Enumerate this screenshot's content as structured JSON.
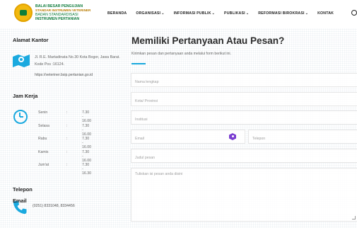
{
  "header": {
    "brand_line1": "BALAI BESAR PENGUJIAN",
    "brand_line2": "STANDAR INSTRUMEN VETERINER",
    "brand_line3": "BADAN STANDARDISASI",
    "brand_line4": "INSTRUMEN PERTANIAN",
    "nav": [
      {
        "label": "BERANDA",
        "chevron": false
      },
      {
        "label": "ORGANISASI",
        "chevron": true
      },
      {
        "label": "INFORMASI PUBLIK",
        "chevron": true
      },
      {
        "label": "PUBLIKASI",
        "chevron": true
      },
      {
        "label": "REFORMASI BIROKRASI",
        "chevron": true
      },
      {
        "label": "KONTAK",
        "chevron": false
      }
    ],
    "chevron_glyph": "⌄"
  },
  "left": {
    "address_title": "Alamat Kantor",
    "address": "Jl. R.E. Martadinata No.30 Kota Bogor, Jawa Barat. Kode Pos :16124.",
    "url": "https://veteriner.bsip.pertanian.go.id",
    "hours_title": "Jam Kerja",
    "hours": [
      {
        "day": "Senin",
        "sep": ":",
        "time": "7.30 - 16.00"
      },
      {
        "day": "Selasa",
        "sep": ":",
        "time": "7.30 - 16.00"
      },
      {
        "day": "Rabu",
        "sep": ":",
        "time": "7.30 - 16.00"
      },
      {
        "day": "Kamis",
        "sep": ":",
        "time": "7.30 - 16.00"
      },
      {
        "day": "Jum'at",
        "sep": ":",
        "time": "7.30 - 16.30"
      }
    ],
    "phone_title": "Telepon",
    "phone": "(0251) 8331048, 8334456",
    "email_title": "Email"
  },
  "form": {
    "title": "Memiliki Pertanyaan Atau Pesan?",
    "subtitle": "Kirimkan pesan dan pertanyaan anda melalui form berikut ini.",
    "name_placeholder": "Nama lengkap",
    "city_placeholder": "Kota/ Provinsi",
    "institution_placeholder": "Institusi",
    "email_placeholder": "Email",
    "phone_placeholder": "Telepon",
    "subject_placeholder": "Judul pesan",
    "message_placeholder": "Tuliskan isi pesan anda disini"
  },
  "colors": {
    "accent": "#18a7dc",
    "brand_green": "#0b7a3a",
    "brand_gold": "#f2b90f"
  },
  "icons": {
    "map": "map-icon",
    "clock": "clock-icon",
    "phone": "phone-icon",
    "search": "search-icon",
    "grammarly": "grammarly-icon"
  }
}
